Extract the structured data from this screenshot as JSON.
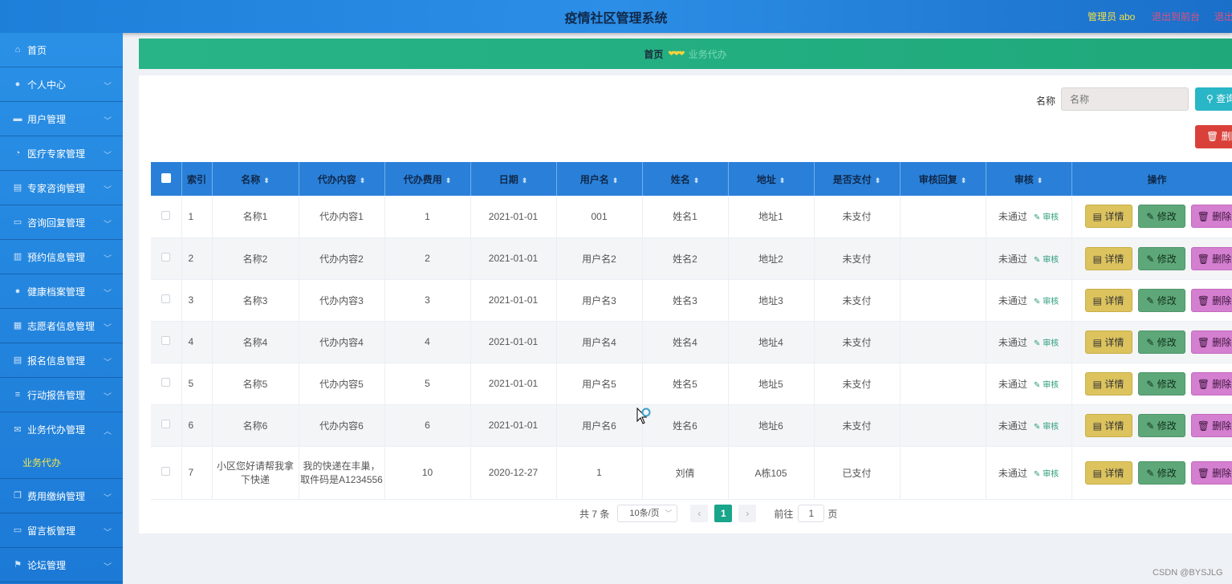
{
  "header": {
    "title": "疫情社区管理系统",
    "admin_user": "管理员 abo",
    "back_link": "退出到前台",
    "logout_link": "退出登录"
  },
  "sidebar": {
    "items": [
      {
        "label": "首页",
        "icon": "home-icon",
        "chevron": false
      },
      {
        "label": "个人中心",
        "icon": "user-icon",
        "chevron": true
      },
      {
        "label": "用户管理",
        "icon": "monitor-icon",
        "chevron": true
      },
      {
        "label": "医疗专家管理",
        "icon": "gauge-icon",
        "chevron": true
      },
      {
        "label": "专家咨询管理",
        "icon": "clipboard-icon",
        "chevron": true
      },
      {
        "label": "咨询回复管理",
        "icon": "message-icon",
        "chevron": true
      },
      {
        "label": "预约信息管理",
        "icon": "bar-chart-icon",
        "chevron": true
      },
      {
        "label": "健康档案管理",
        "icon": "user-icon",
        "chevron": true
      },
      {
        "label": "志愿者信息管理",
        "icon": "grid-icon",
        "chevron": true
      },
      {
        "label": "报名信息管理",
        "icon": "clipboard-icon",
        "chevron": true
      },
      {
        "label": "行动报告管理",
        "icon": "list-icon",
        "chevron": true
      },
      {
        "label": "业务代办管理",
        "icon": "mail-icon",
        "chevron": true,
        "open": true
      }
    ],
    "submenu": {
      "label": "业务代办"
    },
    "items_after": [
      {
        "label": "费用缴纳管理",
        "icon": "copy-icon",
        "chevron": true
      },
      {
        "label": "留言板管理",
        "icon": "message-icon",
        "chevron": true
      },
      {
        "label": "论坛管理",
        "icon": "flag-icon",
        "chevron": true
      }
    ]
  },
  "breadcrumb": {
    "home": "首页",
    "separator": "❤❤❤",
    "current": "业务代办"
  },
  "search": {
    "label": "名称",
    "placeholder": "名称",
    "button": "查询"
  },
  "delete_button": "删除",
  "table": {
    "columns": [
      "索引",
      "名称",
      "代办内容",
      "代办费用",
      "日期",
      "用户名",
      "姓名",
      "地址",
      "是否支付",
      "审核回复",
      "审核",
      "操作"
    ],
    "rows": [
      {
        "index": "1",
        "name": "名称1",
        "content": "代办内容1",
        "fee": "1",
        "date": "2021-01-01",
        "username": "001",
        "realname": "姓名1",
        "address": "地址1",
        "paid": "未支付",
        "reply": "",
        "audit": "未通过"
      },
      {
        "index": "2",
        "name": "名称2",
        "content": "代办内容2",
        "fee": "2",
        "date": "2021-01-01",
        "username": "用户名2",
        "realname": "姓名2",
        "address": "地址2",
        "paid": "未支付",
        "reply": "",
        "audit": "未通过"
      },
      {
        "index": "3",
        "name": "名称3",
        "content": "代办内容3",
        "fee": "3",
        "date": "2021-01-01",
        "username": "用户名3",
        "realname": "姓名3",
        "address": "地址3",
        "paid": "未支付",
        "reply": "",
        "audit": "未通过"
      },
      {
        "index": "4",
        "name": "名称4",
        "content": "代办内容4",
        "fee": "4",
        "date": "2021-01-01",
        "username": "用户名4",
        "realname": "姓名4",
        "address": "地址4",
        "paid": "未支付",
        "reply": "",
        "audit": "未通过"
      },
      {
        "index": "5",
        "name": "名称5",
        "content": "代办内容5",
        "fee": "5",
        "date": "2021-01-01",
        "username": "用户名5",
        "realname": "姓名5",
        "address": "地址5",
        "paid": "未支付",
        "reply": "",
        "audit": "未通过"
      },
      {
        "index": "6",
        "name": "名称6",
        "content": "代办内容6",
        "fee": "6",
        "date": "2021-01-01",
        "username": "用户名6",
        "realname": "姓名6",
        "address": "地址6",
        "paid": "未支付",
        "reply": "",
        "audit": "未通过"
      },
      {
        "index": "7",
        "name": "小区您好请帮我拿下快递",
        "content": "我的快递在丰巢，取件码是A1234556",
        "fee": "10",
        "date": "2020-12-27",
        "username": "1",
        "realname": "刘倩",
        "address": "A栋105",
        "paid": "已支付",
        "reply": "",
        "audit": "未通过"
      }
    ],
    "audit_link": "审核",
    "actions": {
      "detail": "详情",
      "edit": "修改",
      "delete": "删除"
    }
  },
  "pager": {
    "total": "共 7 条",
    "page_size": "10条/页",
    "current_page": "1",
    "goto_label": "前往",
    "goto_value": "1",
    "page_suffix": "页"
  },
  "watermark": "CSDN @BYSJLG",
  "colors": {
    "header": "#1e7fd9",
    "sidebar": "#2a90e6",
    "breadcrumb": "#28b487",
    "table_header": "#2a80d8",
    "active_sub": "#f5e84a",
    "detail_btn": "#dcc35e",
    "edit_btn": "#5ea779",
    "delete_btn": "#d47fd0",
    "pager_active": "#18a58a"
  }
}
